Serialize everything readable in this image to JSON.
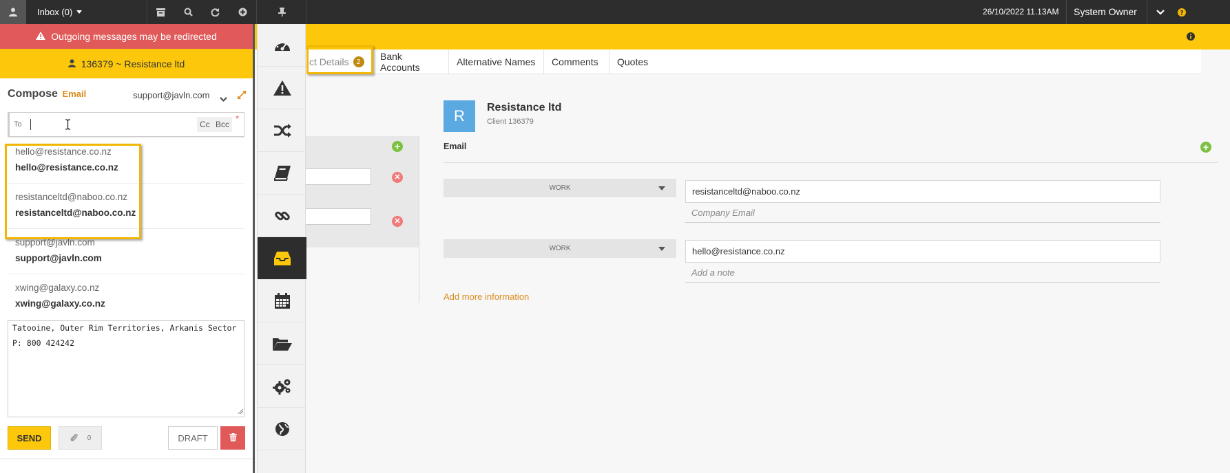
{
  "topbar": {
    "inbox_label": "Inbox (0)",
    "datetime": "26/10/2022 11.13AM",
    "user": "System Owner"
  },
  "compose": {
    "warning": "Outgoing messages may be redirected",
    "client": "136379 ~ Resistance ltd",
    "title": "Compose",
    "subtitle": "Email",
    "from": "support@javln.com",
    "to_label": "To",
    "cc_label": "Cc",
    "bcc_label": "Bcc",
    "required_mark": "*",
    "suggestions": [
      {
        "line1": "hello@resistance.co.nz",
        "line2": "hello@resistance.co.nz"
      },
      {
        "line1": "resistanceltd@naboo.co.nz",
        "line2": "resistanceltd@naboo.co.nz"
      },
      {
        "line1": "support@javln.com",
        "line2": "support@javln.com"
      },
      {
        "line1": "xwing@galaxy.co.nz",
        "line2": "xwing@galaxy.co.nz"
      }
    ],
    "body_line1": "Tatooine, Outer Rim Territories, Arkanis Sector",
    "body_line2": "P: 800 424242",
    "send_label": "SEND",
    "attach_count": "0",
    "draft_label": "DRAFT"
  },
  "tabs": [
    {
      "label": "ct Details",
      "badge": "2"
    },
    {
      "label": "Bank Accounts"
    },
    {
      "label": "Alternative Names"
    },
    {
      "label": "Comments"
    },
    {
      "label": "Quotes"
    }
  ],
  "contact": {
    "avatar_letter": "R",
    "name": "Resistance ltd",
    "subtitle": "Client 136379",
    "email_section_label": "Email",
    "emails": [
      {
        "type": "WORK",
        "value": "resistanceltd@naboo.co.nz",
        "note": "Company Email"
      },
      {
        "type": "WORK",
        "value": "hello@resistance.co.nz",
        "note": "Add a note"
      }
    ],
    "add_more": "Add more information"
  },
  "colors": {
    "accent_yellow": "#fdc80b",
    "warning_red": "#e05a5a",
    "dark_bar": "#2d2d2d",
    "link_orange": "#d88a1c",
    "highlight": "#f2b705"
  },
  "icons": {
    "rail": [
      "dashboard-icon",
      "warning-icon",
      "shuffle-icon",
      "book-icon",
      "link-icon",
      "inbox-icon",
      "calendar-icon",
      "folder-open-icon",
      "gears-icon",
      "globe-icon"
    ]
  }
}
